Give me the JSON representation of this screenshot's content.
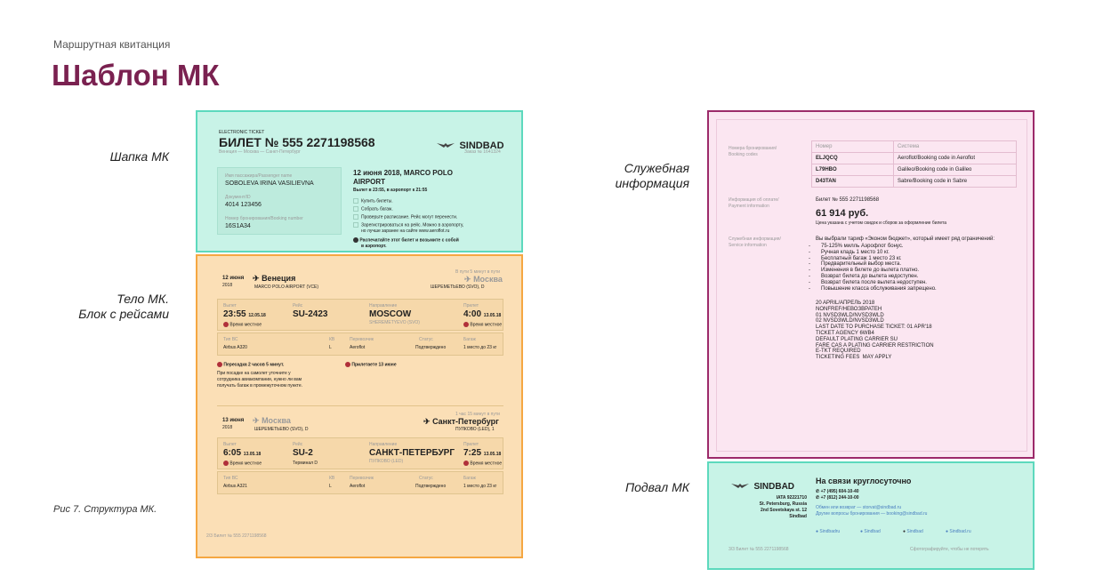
{
  "page": {
    "breadcrumb": "Маршрутная квитанция",
    "title": "Шаблон МК",
    "caption": "Рис 7. Структура МК."
  },
  "labels": {
    "header": "Шапка МК",
    "body_line1": "Тело МК.",
    "body_line2": "Блок с рейсами",
    "service_line1": "Служебная",
    "service_line2": "информация",
    "footer": "Подвал МК"
  },
  "colors": {
    "title": "#7a2150",
    "teal": "#5dd9bd",
    "orange": "#f5a742",
    "magenta": "#9c2a6a"
  },
  "ticket": {
    "etl": "ELECTRONIC TICKET",
    "number": "БИЛЕТ № 555 2271198568",
    "brand": "SINDBAD",
    "route": "Венеция — Москва — Санкт-Петербург",
    "order": "Заказ № 1641324",
    "passenger_label": "Имя пассажира/Passenger name",
    "passenger": "SOBOLEVA IRINA VASILIEVNA",
    "doc_label": "Документ/ID",
    "doc": "4014 123456",
    "pnr_label": "Номер бронирования/Booking number",
    "pnr": "16S1A34",
    "dep_title1": "12 июня 2018, MARCO POLO",
    "dep_title2": "AIRPORT",
    "dep_note": "Вылет в 23:55, в аэропорт к 21:55",
    "checklist": [
      "Купить билеты.",
      "Собрать багаж.",
      "Проверьте расписание. Рейс могут перенести.",
      "Зарегистрироваться на рейс. Можно в аэропорту,",
      "но лучше заранее на сайте www.aeroflot.ru"
    ],
    "print1": "Распечатайте этот билет и возьмите с собой",
    "print2": "в аэропорт."
  },
  "seg1": {
    "date": "12 июня",
    "year": "2018",
    "from": "Венеция",
    "from_ap": "MARCO POLO AIRPORT (VCE)",
    "duration": "В пути 5 минут в пути",
    "to": "Москва",
    "to_ap": "ШЕРЕМЕТЬЕВО (SVO), D",
    "dep_l": "Вылет",
    "dep_t": "23:55",
    "dep_d": "12.05.18",
    "local": "Время местное",
    "flight_l": "Рейс",
    "flight": "SU-2423",
    "dir_l": "Направление",
    "dir": "MOSCOW",
    "dir_ap": "SHEREMETYEVO (SVO)",
    "arr_l": "Прилет",
    "arr_t": "4:00",
    "arr_d": "13.05.18",
    "ac_l": "Тип ВС",
    "ac": "Airbus A320",
    "cls_l": "КВ",
    "cls": "L",
    "car_l": "Перевозчик",
    "car": "Aeroflot",
    "st_l": "Статус",
    "st": "Подтверждено",
    "bag_l": "Багаж",
    "bag": "1 место до 23 кг",
    "transfer": "Пересадка 2 часов 5 минут.",
    "arrive": "Прилетаете 13 июне",
    "note1": "При посадке на самолет уточните у",
    "note2": "сотрудника авиакомпании, нужно ли вам",
    "note3": "получать багаж в промежуточном пункте."
  },
  "seg2": {
    "date": "13 июня",
    "year": "2018",
    "from": "Москва",
    "from_ap": "ШЕРЕМЕТЬЕВО (SVO), D",
    "duration": "1 час 15 минут в пути",
    "to": "Санкт-Петербург",
    "to_ap": "ПУЛКОВО (LED), 1",
    "dep_l": "Вылет",
    "dep_t": "6:05",
    "dep_d": "13.05.18",
    "local": "Время местное",
    "flight_l": "Рейс",
    "flight": "SU-2",
    "term": "Терминал D",
    "dir_l": "Направление",
    "dir": "САНКТ-ПЕТЕРБУРГ",
    "dir_ap": "ПУЛКОВО (LED)",
    "arr_l": "Прилет",
    "arr_t": "7:25",
    "arr_d": "13.05.18",
    "ac_l": "Тип ВС",
    "ac": "Airbus A321",
    "cls_l": "КВ",
    "cls": "L",
    "car_l": "Перевозчик",
    "car": "Aeroflot",
    "st_l": "Статус",
    "st": "Подтверждено",
    "bag_l": "Багаж",
    "bag": "1 место до 23 кг"
  },
  "page_footer1": "2/3   Билет № 555 2271198568",
  "service": {
    "bk_label1": "Номера бронирования/",
    "bk_label2": "Booking codes",
    "col1": "Номер",
    "col2": "Система",
    "rows": [
      [
        "ELJQCQ",
        "Aeroflot/Booking code in Aeroflot"
      ],
      [
        "L79HBO",
        "Galileo/Booking code in Galileo"
      ],
      [
        "D43TAN",
        "Sabre/Booking code in Sabre"
      ]
    ],
    "pay_label1": "Информация об оплате/",
    "pay_label2": "Payment information",
    "pay_ticket": "Билет № 555 2271198568",
    "price": "61 914 руб.",
    "price_note": "Цена указана с учетом скидок и сборов за оформление билета",
    "si_label1": "Служебная информация/",
    "si_label2": "Service information",
    "tariff": "Вы выбрали тариф «Эконом бюджет», который имеет ряд ограничений:",
    "rules": [
      "75-125% милль Аэрофлот бонус.",
      "Ручная кладь 1 место 10 кг.",
      "Бесплатный багаж 1 место 23 кг.",
      "Предварительный выбор места.",
      "Изменения в билете до вылета платно.",
      "Возврат билета до вылета недоступен.",
      "Возврат билета после вылета недоступен.",
      "Повышение класса обслуживания запрещено."
    ],
    "codes": [
      "20 APRIL/АПРЕЛЬ 2018",
      "NONFREF/НЕВОЗВРАТЕН",
      "01 NVSD3WLD/NVSD3WLD",
      "02 NVSD3WLD/NVSD3WLD",
      "LAST DATE TO PURCHASE TICKET: 01 APR'18",
      "TICKET AGENCY 6WB4",
      "DEFAULT PLATING CARRIER SU",
      "FARE CAS A PLATING CARRIER RESTRICTION",
      "E-TKT REQUIRED",
      "TICKETING FEES  MAY APPLY"
    ]
  },
  "footer": {
    "brand": "SINDBAD",
    "iata": "IATA 92221710",
    "city": "St. Petersburg, Russia",
    "addr": "2nd Sovetskaya st. 12",
    "name": "Sindbad",
    "title": "На связи круглосуточно",
    "phone1": "+7 (495) 604-10-40",
    "phone2": "+7 (812) 244-10-00",
    "exch": "Обмен или возврат — storvat@sindbad.ru",
    "other": "Другие вопросы бронирования — booking@sindbad.ru",
    "socials": [
      "Sindbadru",
      "Sindbad",
      "Sindbad",
      "Sindbad.ru"
    ],
    "page": "3/3   Билет № 555 2271198568",
    "hint": "Сфотографируйте, чтобы не потерять"
  }
}
